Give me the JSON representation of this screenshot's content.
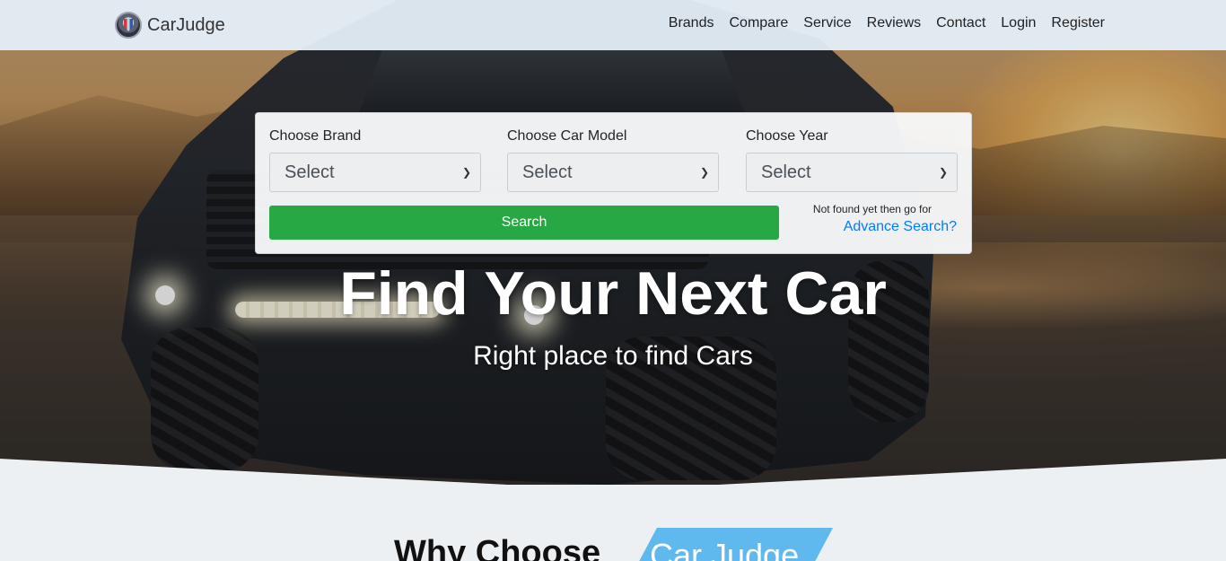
{
  "navbar": {
    "brand": "CarJudge",
    "links": [
      "Brands",
      "Compare",
      "Service",
      "Reviews",
      "Contact",
      "Login",
      "Register"
    ]
  },
  "search": {
    "brand_label": "Choose Brand",
    "brand_value": "Select",
    "model_label": "Choose Car Model",
    "model_value": "Select",
    "year_label": "Choose Year",
    "year_value": "Select",
    "search_button": "Search",
    "not_found_text": "Not found yet then go for",
    "advance_link": "Advance Search?"
  },
  "hero": {
    "title": "Find Your Next Car",
    "subtitle": "Right place to find Cars"
  },
  "why": {
    "prefix": "Why Choose",
    "highlight": "Car Judge"
  },
  "colors": {
    "search_button": "#28a745",
    "link": "#007bff",
    "badge": "#5fb9ef",
    "navbar": "#e4f0fa"
  }
}
